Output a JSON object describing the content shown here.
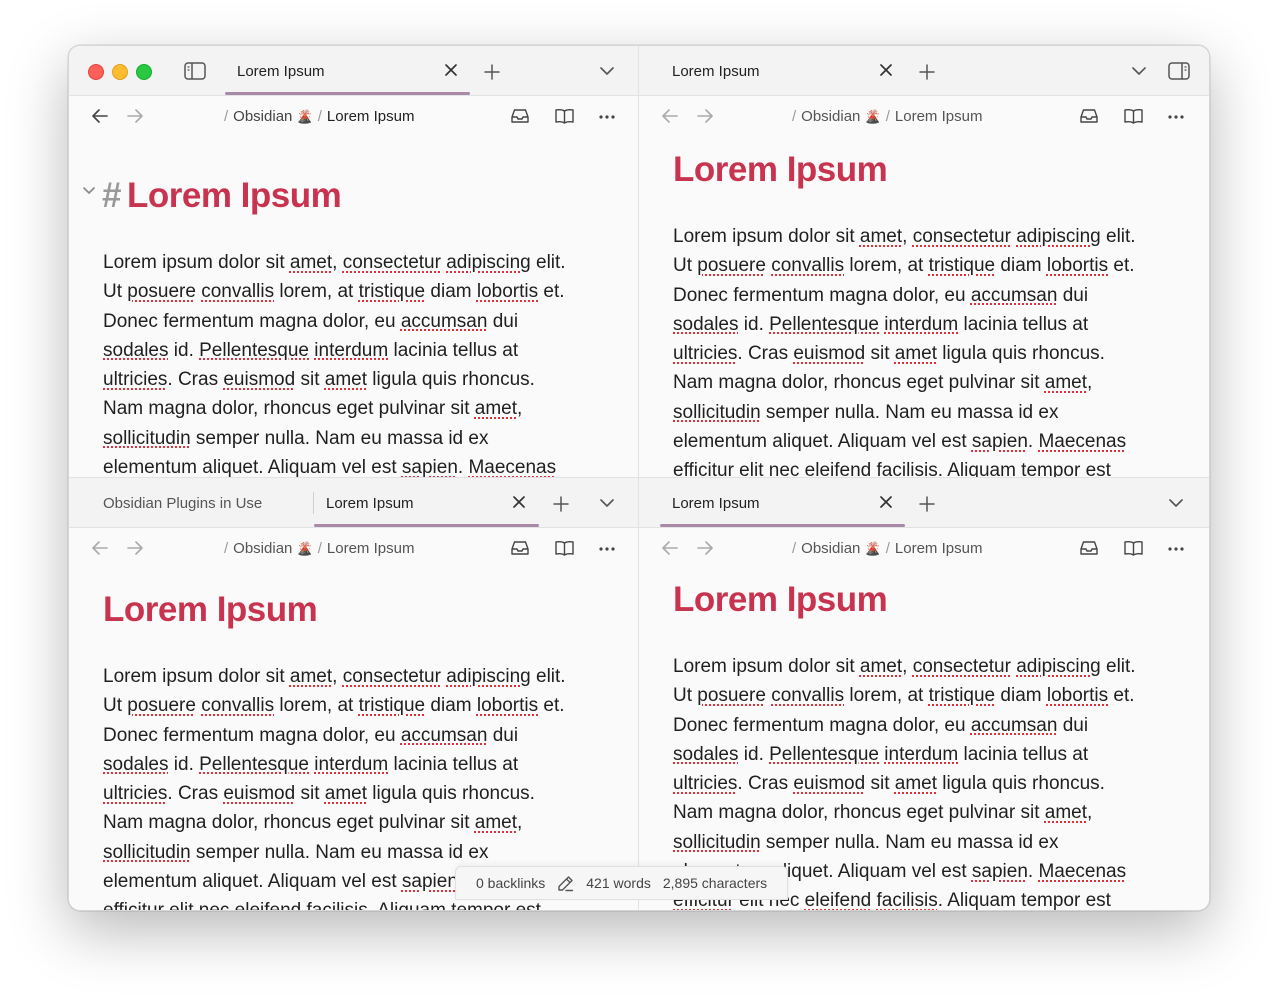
{
  "top_left": {
    "tabs": [
      {
        "label": "Lorem Ipsum"
      }
    ],
    "breadcrumb": {
      "parent": "Obsidian",
      "emoji": "🌋",
      "current": "Lorem Ipsum"
    },
    "heading_marker": "#",
    "heading": "Lorem Ipsum"
  },
  "top_right": {
    "tabs": [
      {
        "label": "Lorem Ipsum"
      }
    ],
    "breadcrumb": {
      "parent": "Obsidian",
      "emoji": "🌋",
      "current": "Lorem Ipsum"
    },
    "heading": "Lorem Ipsum"
  },
  "bottom_left": {
    "tabs": [
      {
        "label": "Obsidian Plugins in Use"
      },
      {
        "label": "Lorem Ipsum"
      }
    ],
    "breadcrumb": {
      "parent": "Obsidian",
      "emoji": "🌋",
      "current": "Lorem Ipsum"
    },
    "heading": "Lorem Ipsum"
  },
  "bottom_right": {
    "tabs": [
      {
        "label": "Lorem Ipsum"
      }
    ],
    "breadcrumb": {
      "parent": "Obsidian",
      "emoji": "🌋",
      "current": "Lorem Ipsum"
    },
    "heading": "Lorem Ipsum"
  },
  "paragraph_lines": [
    "Lorem ipsum dolor sit [amet], [consectetur] [adipiscing] elit.",
    "Ut [posuere] [convallis] lorem, at [tristique] diam [lobortis] et.",
    "Donec fermentum magna dolor, eu [accumsan] dui",
    "[sodales] id. [Pellentesque] [interdum] lacinia tellus at",
    "[ultricies]. Cras [euismod] sit [amet] ligula quis rhoncus.",
    "Nam magna dolor, rhoncus eget pulvinar sit [amet],",
    "[sollicitudin] semper nulla. Nam eu massa id ex",
    "elementum aliquet. Aliquam vel est [sapien]. [Maecenas]",
    "[efficitur] elit nec [eleifend] [facilisis]. Aliquam tempor est"
  ],
  "statusbar": {
    "backlinks": "0 backlinks",
    "words": "421 words",
    "characters": "2,895 characters"
  },
  "colors": {
    "heading": "#c8344f",
    "tab_underline": "#a88aa8",
    "spellcheck": "#e0303a"
  }
}
